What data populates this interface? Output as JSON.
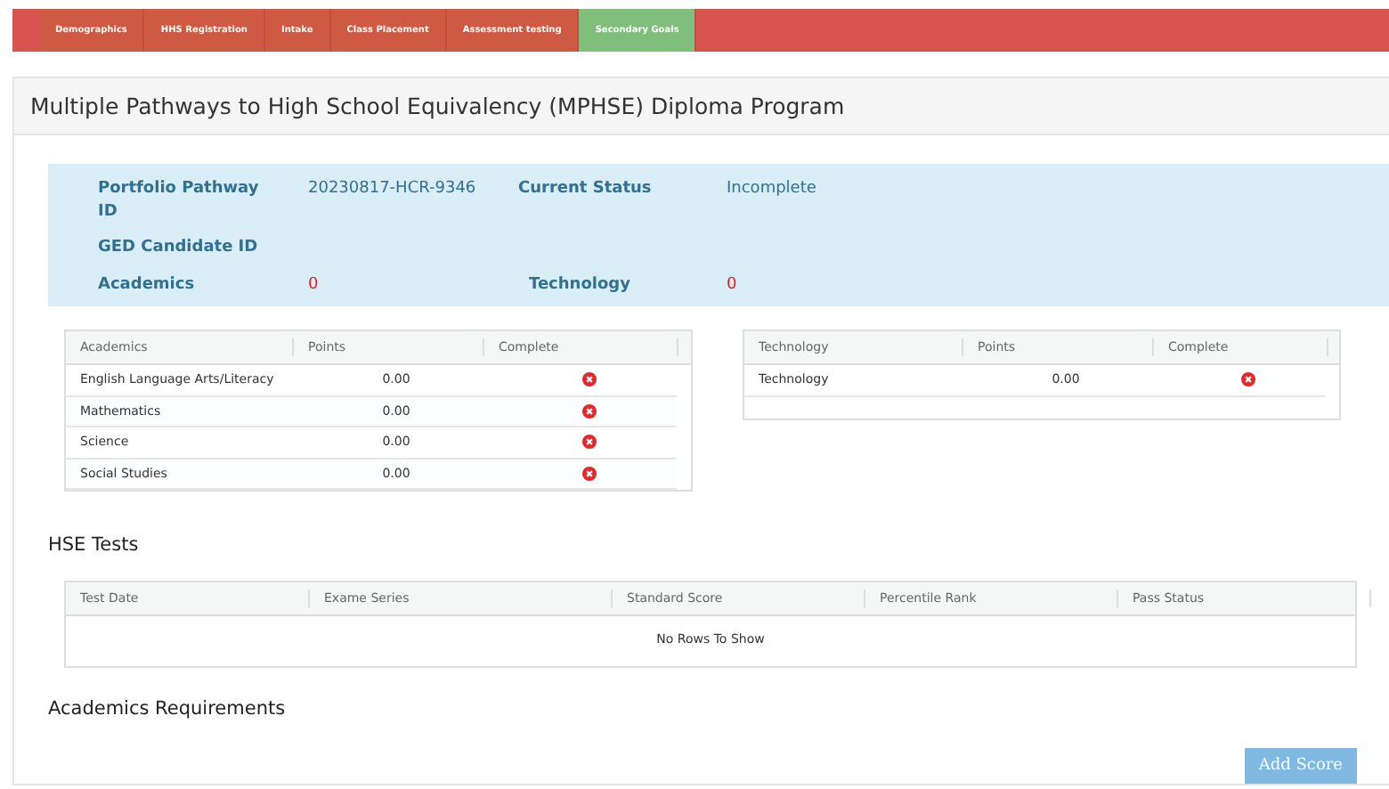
{
  "nav_tabs": [
    {
      "label": "Demographics",
      "selected": false
    },
    {
      "label": "HHS Registration",
      "selected": false
    },
    {
      "label": "Intake",
      "selected": false
    },
    {
      "label": "Class Placement",
      "selected": false
    },
    {
      "label": "Assessment testing",
      "selected": false
    },
    {
      "label": "Secondary Goals",
      "selected": true
    }
  ],
  "panel_title": "Multiple Pathways to High School Equivalency (MPHSE) Diploma Program",
  "summary": {
    "portfolio_label": "Portfolio Pathway ID",
    "portfolio_value": "20230817-HCR-9346",
    "status_label": "Current Status",
    "status_value": "Incomplete",
    "ged_label": "GED Candidate ID",
    "academics_label": "Academics",
    "academics_value": "0",
    "technology_label": "Technology",
    "technology_value": "0"
  },
  "academics_table": {
    "columns": [
      "Academics",
      "Points",
      "Complete"
    ],
    "rows": [
      {
        "name": "English Language Arts/Literacy",
        "points": "0.00",
        "complete": false
      },
      {
        "name": "Mathematics",
        "points": "0.00",
        "complete": false
      },
      {
        "name": "Science",
        "points": "0.00",
        "complete": false
      },
      {
        "name": "Social Studies",
        "points": "0.00",
        "complete": false
      }
    ]
  },
  "technology_table": {
    "columns": [
      "Technology",
      "Points",
      "Complete"
    ],
    "rows": [
      {
        "name": "Technology",
        "points": "0.00",
        "complete": false
      }
    ]
  },
  "hse_heading": "HSE Tests",
  "hse_table": {
    "columns": [
      "Test Date",
      "Exame Series",
      "Standard Score",
      "Percentile Rank",
      "Pass Status"
    ],
    "empty_text": "No Rows To Show"
  },
  "requirements_heading": "Academics Requirements",
  "add_button": "Add Score"
}
